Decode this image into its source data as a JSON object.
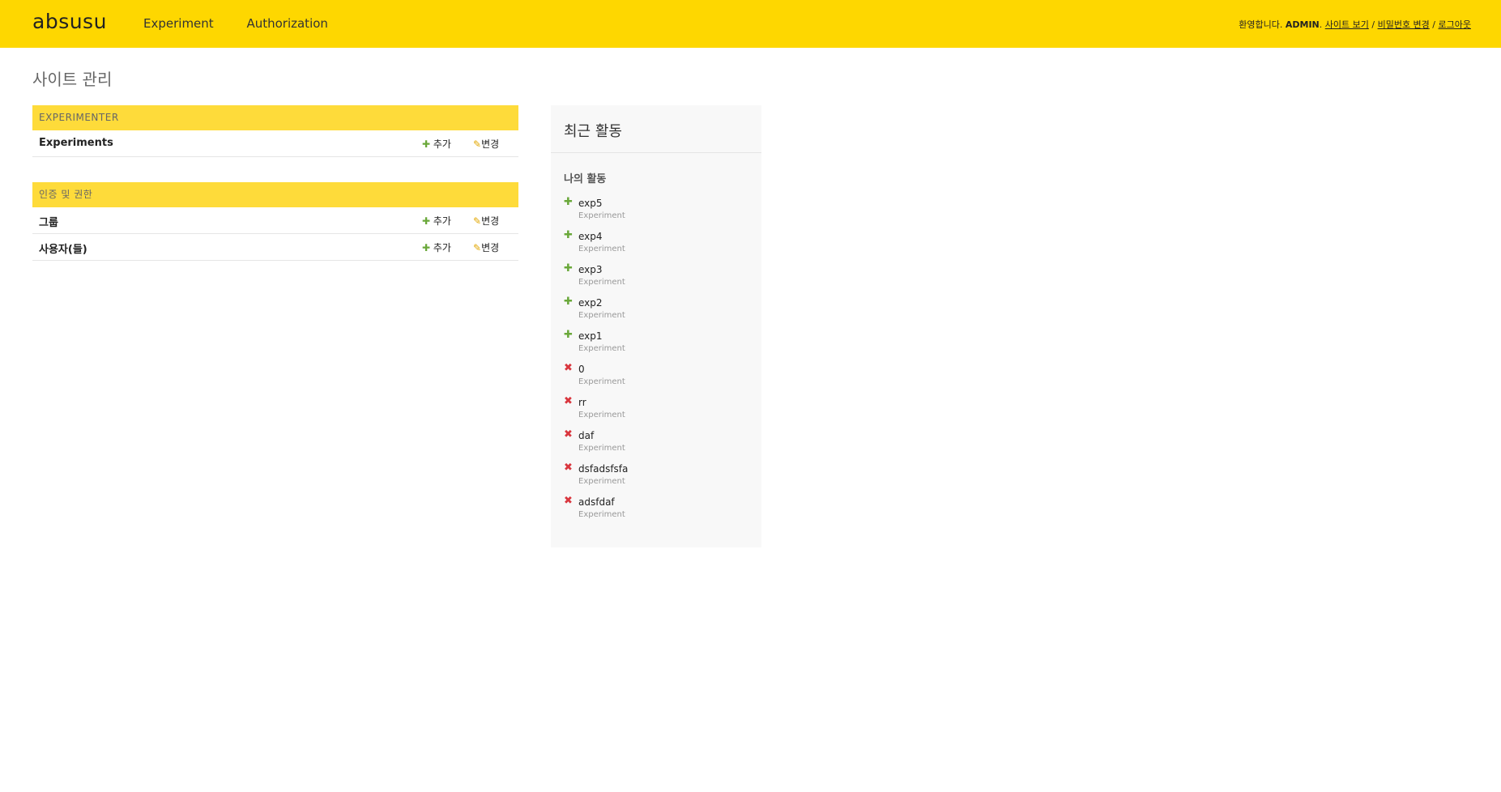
{
  "header": {
    "brand": "absusu",
    "nav": [
      {
        "label": "Experiment"
      },
      {
        "label": "Authorization"
      }
    ],
    "welcome": "환영합니다.",
    "user": "ADMIN",
    "view_site": "사이트 보기",
    "change_password": "비밀번호 변경",
    "logout": "로그아웃",
    "sep": "/"
  },
  "page": {
    "title": "사이트 관리"
  },
  "modules": [
    {
      "caption": "EXPERIMENTER",
      "rows": [
        {
          "name": "Experiments",
          "add": "추가",
          "change": "변경"
        }
      ]
    },
    {
      "caption": "인증 및 권한",
      "rows": [
        {
          "name": "그룹",
          "add": "추가",
          "change": "변경"
        },
        {
          "name": "사용자(들)",
          "add": "추가",
          "change": "변경"
        }
      ]
    }
  ],
  "recent": {
    "title": "최근 활동",
    "subtitle": "나의 활동",
    "actions": [
      {
        "icon": "plus-icon",
        "name": "exp5",
        "type": "Experiment"
      },
      {
        "icon": "plus-icon",
        "name": "exp4",
        "type": "Experiment"
      },
      {
        "icon": "plus-icon",
        "name": "exp3",
        "type": "Experiment"
      },
      {
        "icon": "plus-icon",
        "name": "exp2",
        "type": "Experiment"
      },
      {
        "icon": "plus-icon",
        "name": "exp1",
        "type": "Experiment"
      },
      {
        "icon": "delete-icon",
        "name": "0",
        "type": "Experiment"
      },
      {
        "icon": "delete-icon",
        "name": "rr",
        "type": "Experiment"
      },
      {
        "icon": "delete-icon",
        "name": "daf",
        "type": "Experiment"
      },
      {
        "icon": "delete-icon",
        "name": "dsfadsfsfa",
        "type": "Experiment"
      },
      {
        "icon": "delete-icon",
        "name": "adsfdaf",
        "type": "Experiment"
      }
    ]
  },
  "colors": {
    "header": "#fed700",
    "caption": "#fedb3a",
    "add": "#6aa83a",
    "change": "#e2a700",
    "delete": "#d9363e"
  }
}
